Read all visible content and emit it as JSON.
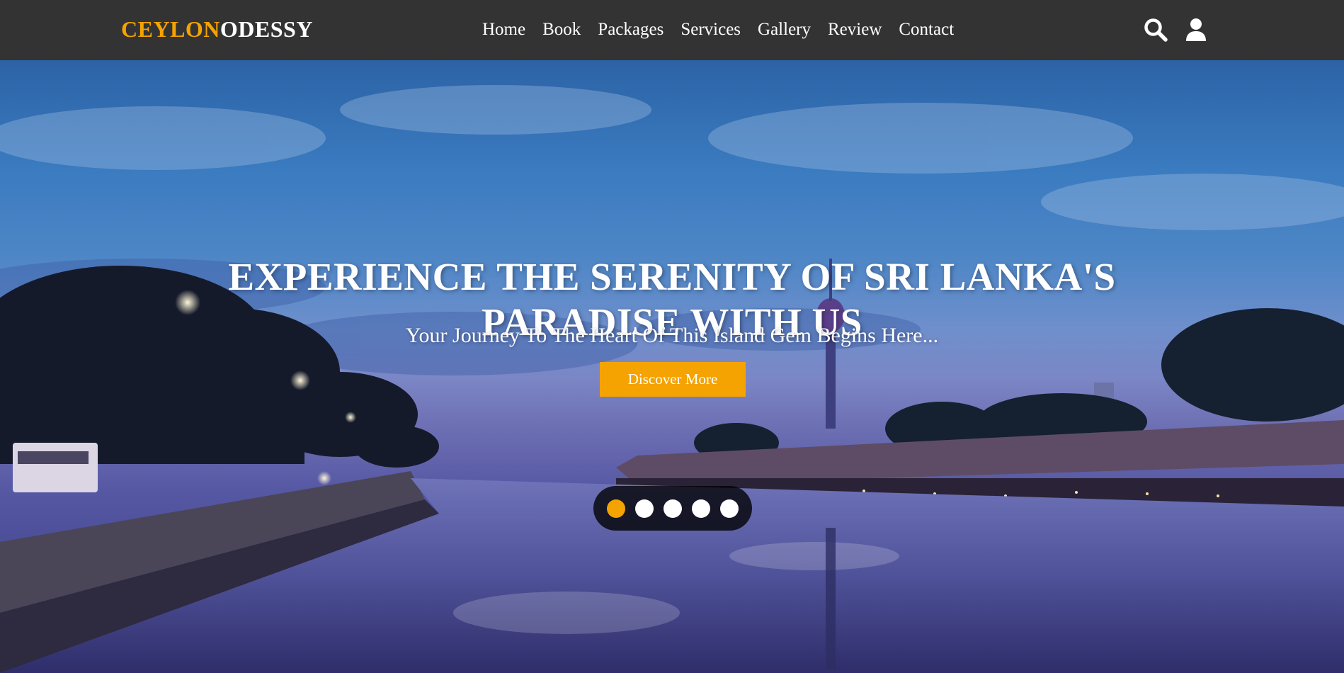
{
  "brand": {
    "part1": "CEYLON",
    "part2": "ODESSY",
    "accent_color": "#f5a300"
  },
  "nav": {
    "items": [
      {
        "label": "Home"
      },
      {
        "label": "Book"
      },
      {
        "label": "Packages"
      },
      {
        "label": "Services"
      },
      {
        "label": "Gallery"
      },
      {
        "label": "Review"
      },
      {
        "label": "Contact"
      }
    ]
  },
  "header_icons": {
    "search": "search-icon",
    "user": "user-icon"
  },
  "hero": {
    "title_line1": "EXPERIENCE THE SERENITY OF SRI LANKA'S",
    "title_line2": "PARADISE WITH US",
    "subtitle": "Your Journey To The Heart Of This Island Gem Begins Here...",
    "cta_label": "Discover More",
    "slider": {
      "count": 5,
      "active_index": 0
    }
  },
  "colors": {
    "header_bg": "#333333",
    "accent": "#f5a300",
    "text": "#ffffff"
  }
}
